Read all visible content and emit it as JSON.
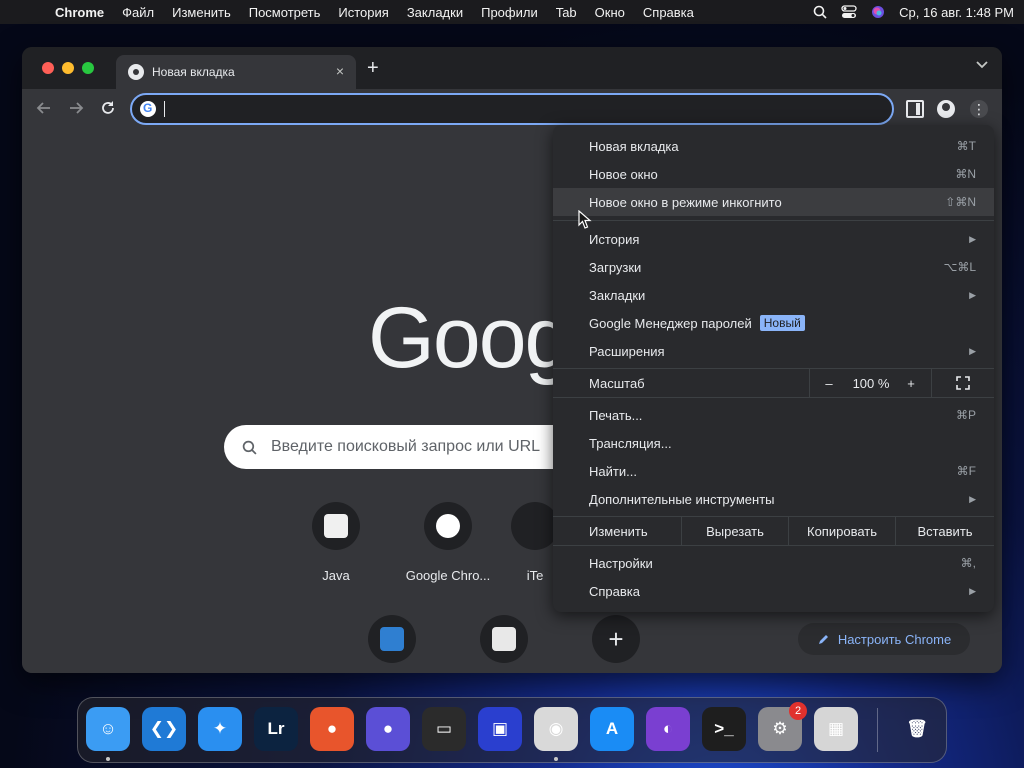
{
  "menubar": {
    "app_name": "Chrome",
    "items": [
      "Файл",
      "Изменить",
      "Посмотреть",
      "История",
      "Закладки",
      "Профили",
      "Tab",
      "Окно",
      "Справка"
    ],
    "clock": "Ср, 16 авг.  1:48 PM"
  },
  "tab": {
    "title": "Новая вкладка",
    "close": "×"
  },
  "newtab": "+",
  "ntp": {
    "logo": "Goog",
    "search_placeholder": "Введите поисковый запрос или URL",
    "shortcuts": [
      {
        "label": "Java"
      },
      {
        "label": "Google Chro..."
      },
      {
        "label": "iTe"
      }
    ],
    "add_shortcut": "+",
    "customize": "Настроить Chrome"
  },
  "menu": {
    "new_tab": {
      "label": "Новая вкладка",
      "shortcut": "⌘T"
    },
    "new_window": {
      "label": "Новое окно",
      "shortcut": "⌘N"
    },
    "incognito": {
      "label": "Новое окно в режиме инкогнито",
      "shortcut": "⇧⌘N"
    },
    "history": {
      "label": "История"
    },
    "downloads": {
      "label": "Загрузки",
      "shortcut": "⌥⌘L"
    },
    "bookmarks": {
      "label": "Закладки"
    },
    "passwords": {
      "label": "Google Менеджер паролей",
      "badge": "Новый"
    },
    "extensions": {
      "label": "Расширения"
    },
    "zoom": {
      "label": "Масштаб",
      "minus": "–",
      "value": "100 %",
      "plus": "+"
    },
    "print": {
      "label": "Печать...",
      "shortcut": "⌘P"
    },
    "cast": {
      "label": "Трансляция..."
    },
    "find": {
      "label": "Найти...",
      "shortcut": "⌘F"
    },
    "more_tools": {
      "label": "Дополнительные инструменты"
    },
    "edit": {
      "label": "Изменить",
      "cut": "Вырезать",
      "copy": "Копировать",
      "paste": "Вставить"
    },
    "settings": {
      "label": "Настройки",
      "shortcut": "⌘,"
    },
    "help": {
      "label": "Справка"
    }
  },
  "dock": {
    "apps": [
      {
        "name": "finder-icon",
        "glyph": "☺",
        "color": "#3b9cf3"
      },
      {
        "name": "vscode-icon",
        "glyph": "❮❯",
        "color": "#1f7ad6"
      },
      {
        "name": "safari-icon",
        "glyph": "✦",
        "color": "#2a8ff0"
      },
      {
        "name": "lightroom-icon",
        "glyph": "Lr",
        "color": "#0c2340"
      },
      {
        "name": "firefox-icon",
        "glyph": "●",
        "color": "#e8552c"
      },
      {
        "name": "firefox-dev-icon",
        "glyph": "●",
        "color": "#5b4fd6"
      },
      {
        "name": "console-icon",
        "glyph": "▭",
        "color": "#2b2b2b"
      },
      {
        "name": "framed-icon",
        "glyph": "▣",
        "color": "#2a3fcf"
      },
      {
        "name": "chrome-icon",
        "glyph": "◉",
        "color": "#d9d9d9"
      },
      {
        "name": "app-store-icon",
        "glyph": "A",
        "color": "#1a8cf5"
      },
      {
        "name": "github-icon",
        "glyph": "◐",
        "color": "#7a3fd1"
      },
      {
        "name": "terminal-icon",
        "glyph": ">_",
        "color": "#1e1e1e"
      },
      {
        "name": "system-settings-icon",
        "glyph": "⚙",
        "color": "#8a8a8e",
        "badge": "2"
      },
      {
        "name": "launchpad-icon",
        "glyph": "▦",
        "color": "#d6d6d6"
      },
      {
        "name": "trash-icon",
        "glyph": "🗑",
        "color": "transparent"
      }
    ]
  }
}
